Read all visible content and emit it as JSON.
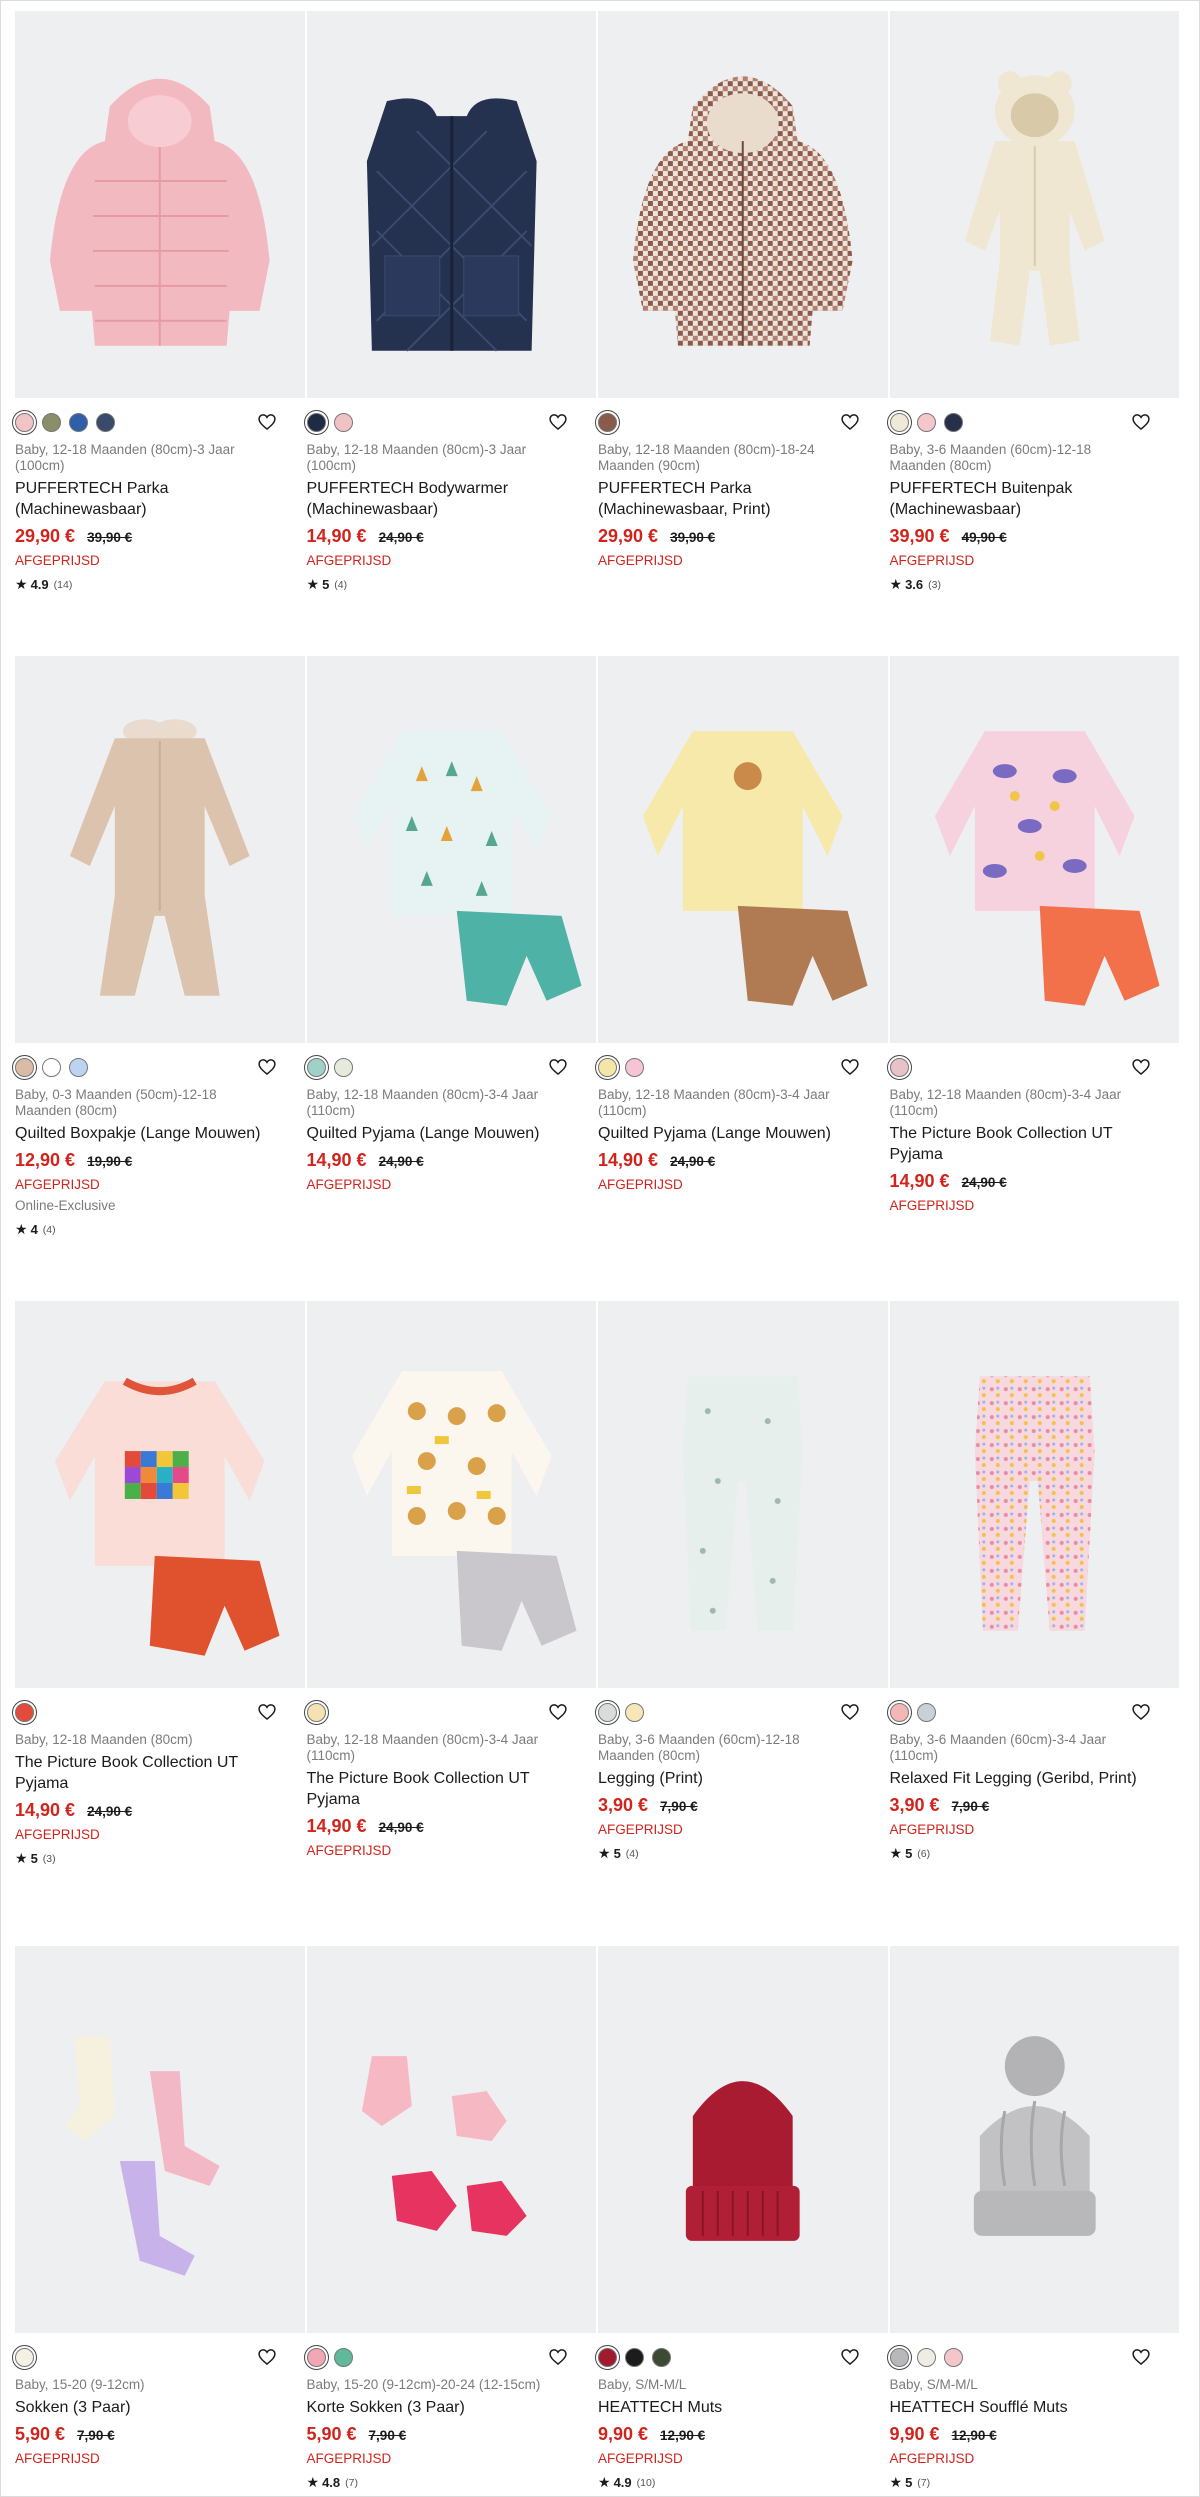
{
  "products": [
    {
      "swatches": [
        "#f2c4c8",
        "#8a8f6a",
        "#2f5fa8",
        "#3a4a6a"
      ],
      "meta": "Baby, 12-18 Maanden (80cm)-3 Jaar (100cm)",
      "name": "PUFFERTECH Parka (Machinewasbaar)",
      "price": "29,90 €",
      "old_price": "39,90 €",
      "promo": "AFGEPRIJSD",
      "extra": "",
      "score": "4.9",
      "count": "(14)",
      "illustration": "pink-puffer-jacket"
    },
    {
      "swatches": [
        "#1f2a44",
        "#f0c2c6"
      ],
      "meta": "Baby, 12-18 Maanden (80cm)-3 Jaar (100cm)",
      "name": "PUFFERTECH Bodywarmer (Machinewasbaar)",
      "price": "14,90 €",
      "old_price": "24,90 €",
      "promo": "AFGEPRIJSD",
      "extra": "",
      "score": "5",
      "count": "(4)",
      "illustration": "navy-quilted-vest"
    },
    {
      "swatches": [
        "#8a5a4a"
      ],
      "meta": "Baby, 12-18 Maanden (80cm)-18-24 Maanden (90cm)",
      "name": "PUFFERTECH Parka (Machinewasbaar, Print)",
      "price": "29,90 €",
      "old_price": "39,90 €",
      "promo": "AFGEPRIJSD",
      "extra": "",
      "score": "",
      "count": "",
      "illustration": "checked-puffer-jacket"
    },
    {
      "swatches": [
        "#efe9d8",
        "#f3c7cc",
        "#26304a"
      ],
      "meta": "Baby, 3-6 Maanden (60cm)-12-18 Maanden (80cm)",
      "name": "PUFFERTECH Buitenpak (Machinewasbaar)",
      "price": "39,90 €",
      "old_price": "49,90 €",
      "promo": "AFGEPRIJSD",
      "extra": "",
      "score": "3.6",
      "count": "(3)",
      "illustration": "cream-snowsuit"
    },
    {
      "swatches": [
        "#d9bba6",
        "#ffffff",
        "#bcd4f2"
      ],
      "meta": "Baby, 0-3 Maanden (50cm)-12-18 Maanden (80cm)",
      "name": "Quilted Boxpakje (Lange Mouwen)",
      "price": "12,90 €",
      "old_price": "19,90 €",
      "promo": "AFGEPRIJSD",
      "extra": "Online-Exclusive",
      "score": "4",
      "count": "(4)",
      "illustration": "beige-boxpakje"
    },
    {
      "swatches": [
        "#9fd1c8",
        "#e5eadc"
      ],
      "meta": "Baby, 12-18 Maanden (80cm)-3-4 Jaar (110cm)",
      "name": "Quilted Pyjama (Lange Mouwen)",
      "price": "14,90 €",
      "old_price": "24,90 €",
      "promo": "AFGEPRIJSD",
      "extra": "",
      "score": "",
      "count": "",
      "illustration": "tree-pyjama"
    },
    {
      "swatches": [
        "#f3e7a8",
        "#f6c4d2"
      ],
      "meta": "Baby, 12-18 Maanden (80cm)-3-4 Jaar (110cm)",
      "name": "Quilted Pyjama (Lange Mouwen)",
      "price": "14,90 €",
      "old_price": "24,90 €",
      "promo": "AFGEPRIJSD",
      "extra": "",
      "score": "",
      "count": "",
      "illustration": "yellow-pyjama"
    },
    {
      "swatches": [
        "#e8c2c7"
      ],
      "meta": "Baby, 12-18 Maanden (80cm)-3-4 Jaar (110cm)",
      "name": "The Picture Book Collection UT Pyjama",
      "price": "14,90 €",
      "old_price": "24,90 €",
      "promo": "AFGEPRIJSD",
      "extra": "",
      "score": "",
      "count": "",
      "illustration": "pink-print-pyjama"
    },
    {
      "swatches": [
        "#e24a3a"
      ],
      "meta": "Baby, 12-18 Maanden (80cm)",
      "name": "The Picture Book Collection UT Pyjama",
      "price": "14,90 €",
      "old_price": "24,90 €",
      "promo": "AFGEPRIJSD",
      "extra": "",
      "score": "5",
      "count": "(3)",
      "illustration": "elmer-pyjama"
    },
    {
      "swatches": [
        "#f4e3b0"
      ],
      "meta": "Baby, 12-18 Maanden (80cm)-3-4 Jaar (110cm)",
      "name": "The Picture Book Collection UT Pyjama",
      "price": "14,90 €",
      "old_price": "24,90 €",
      "promo": "AFGEPRIJSD",
      "extra": "",
      "score": "",
      "count": "",
      "illustration": "bear-print-pyjama"
    },
    {
      "swatches": [
        "#d8dddc",
        "#f6e6b8"
      ],
      "meta": "Baby, 3-6 Maanden (60cm)-12-18 Maanden (80cm)",
      "name": "Legging (Print)",
      "price": "3,90 €",
      "old_price": "7,90 €",
      "promo": "AFGEPRIJSD",
      "extra": "",
      "score": "5",
      "count": "(4)",
      "illustration": "mint-legging"
    },
    {
      "swatches": [
        "#f2b8b4",
        "#c9d0d8"
      ],
      "meta": "Baby, 3-6 Maanden (60cm)-3-4 Jaar (110cm)",
      "name": "Relaxed Fit Legging (Geribd, Print)",
      "price": "3,90 €",
      "old_price": "7,90 €",
      "promo": "AFGEPRIJSD",
      "extra": "",
      "score": "5",
      "count": "(6)",
      "illustration": "floral-legging"
    },
    {
      "swatches": [
        "#f4f1e4"
      ],
      "meta": "Baby, 15-20 (9-12cm)",
      "name": "Sokken (3 Paar)",
      "price": "5,90 €",
      "old_price": "7,90 €",
      "promo": "AFGEPRIJSD",
      "extra": "",
      "score": "",
      "count": "",
      "illustration": "socks-pastel"
    },
    {
      "swatches": [
        "#f1a7b4",
        "#5fb99a"
      ],
      "meta": "Baby, 15-20 (9-12cm)-20-24 (12-15cm)",
      "name": "Korte Sokken (3 Paar)",
      "price": "5,90 €",
      "old_price": "7,90 €",
      "promo": "AFGEPRIJSD",
      "extra": "",
      "score": "4.8",
      "count": "(7)",
      "illustration": "socks-pink"
    },
    {
      "swatches": [
        "#a11a2e",
        "#1c1c1c",
        "#3c4a34"
      ],
      "meta": "Baby, S/M-M/L",
      "name": "HEATTECH Muts",
      "price": "9,90 €",
      "old_price": "12,90 €",
      "promo": "AFGEPRIJSD",
      "extra": "",
      "score": "4.9",
      "count": "(10)",
      "illustration": "red-beanie"
    },
    {
      "swatches": [
        "#b8b8ba",
        "#efece4",
        "#f3c6cc"
      ],
      "meta": "Baby, S/M-M/L",
      "name": "HEATTECH Soufflé Muts",
      "price": "9,90 €",
      "old_price": "12,90 €",
      "promo": "AFGEPRIJSD",
      "extra": "",
      "score": "5",
      "count": "(7)",
      "illustration": "grey-bobble-hat"
    }
  ]
}
